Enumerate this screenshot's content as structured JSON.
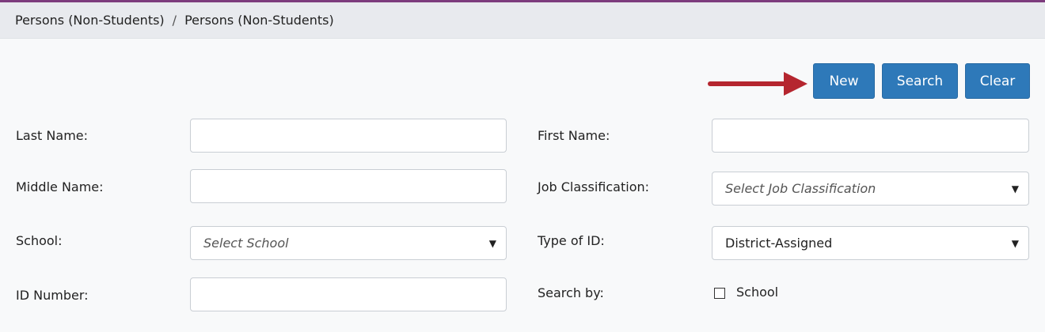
{
  "breadcrumb": {
    "parent": "Persons (Non-Students)",
    "separator": "/",
    "current": "Persons (Non-Students)"
  },
  "toolbar": {
    "new_label": "New",
    "search_label": "Search",
    "clear_label": "Clear"
  },
  "form": {
    "last_name": {
      "label": "Last Name:",
      "value": ""
    },
    "first_name": {
      "label": "First Name:",
      "value": ""
    },
    "middle_name": {
      "label": "Middle Name:",
      "value": ""
    },
    "job_classification": {
      "label": "Job Classification:",
      "placeholder": "Select Job Classification"
    },
    "school": {
      "label": "School:",
      "placeholder": "Select School"
    },
    "type_of_id": {
      "label": "Type of ID:",
      "value": "District-Assigned"
    },
    "id_number": {
      "label": "ID Number:",
      "value": ""
    },
    "search_by": {
      "label": "Search by:",
      "option_label": "School",
      "checked": false
    }
  },
  "colors": {
    "accent": "#2e79b9",
    "arrow": "#b5262f",
    "top_stripe": "#7d3c7d"
  },
  "icons": {
    "dropdown": "caret-down-icon",
    "annotation": "red-arrow-icon"
  }
}
